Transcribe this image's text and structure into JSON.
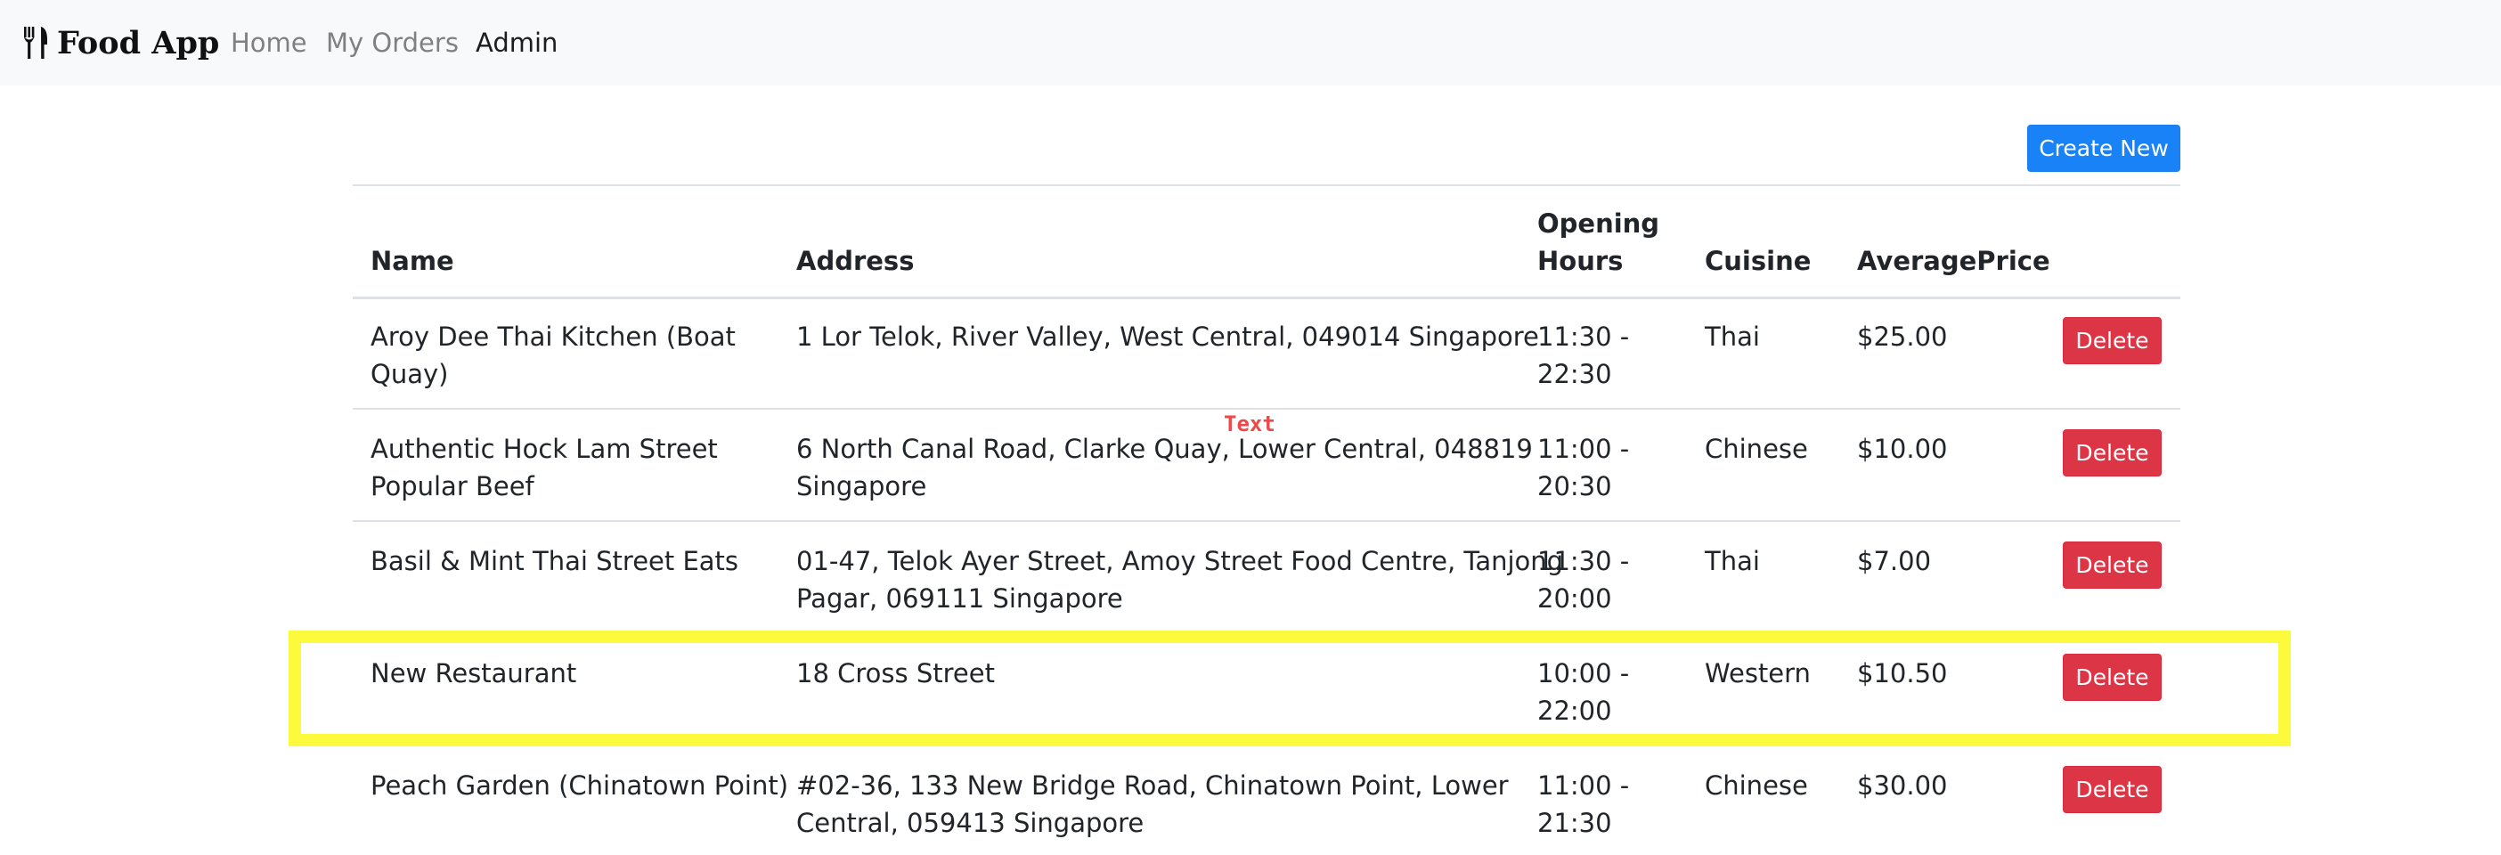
{
  "navbar": {
    "brand": "Food App",
    "brand_icon": "fork-knife-icon",
    "links": [
      "Home",
      "My Orders",
      "Admin"
    ],
    "active_link": "Admin"
  },
  "actions": {
    "create_label": "Create New"
  },
  "table": {
    "headers": {
      "name": "Name",
      "address": "Address",
      "hours_line1": "Opening",
      "hours_line2": "Hours",
      "cuisine": "Cuisine",
      "price": "AveragePrice"
    },
    "rows": [
      {
        "name_l1": "Aroy Dee Thai Kitchen (Boat",
        "name_l2": "Quay)",
        "address_l1": "1 Lor Telok, River Valley, West Central, 049014 Singapore",
        "address_l2": "",
        "hours_l1": "11:30 -",
        "hours_l2": "22:30",
        "cuisine": "Thai",
        "price": "$25.00",
        "delete_label": "Delete"
      },
      {
        "name_l1": "Authentic Hock Lam Street",
        "name_l2": "Popular Beef",
        "address_l1": "6 North Canal Road, Clarke Quay, Lower Central, 048819",
        "address_l2": "Singapore",
        "hours_l1": "11:00 -",
        "hours_l2": "20:30",
        "cuisine": "Chinese",
        "price": "$10.00",
        "delete_label": "Delete"
      },
      {
        "name_l1": "Basil & Mint Thai Street Eats",
        "name_l2": "",
        "address_l1": "01-47, Telok Ayer Street, Amoy Street Food Centre, Tanjong",
        "address_l2": "Pagar, 069111 Singapore",
        "hours_l1": "11:30 -",
        "hours_l2": "20:00",
        "cuisine": "Thai",
        "price": "$7.00",
        "delete_label": "Delete"
      },
      {
        "name_l1": "New Restaurant",
        "name_l2": "",
        "address_l1": "18 Cross Street",
        "address_l2": "",
        "hours_l1": "10:00 -",
        "hours_l2": "22:00",
        "cuisine": "Western",
        "price": "$10.50",
        "delete_label": "Delete"
      },
      {
        "name_l1": "Peach Garden (Chinatown Point)",
        "name_l2": "",
        "address_l1": "#02-36, 133 New Bridge Road, Chinatown Point, Lower",
        "address_l2": "Central, 059413 Singapore",
        "hours_l1": "11:00 -",
        "hours_l2": "21:30",
        "cuisine": "Chinese",
        "price": "$30.00",
        "delete_label": "Delete"
      }
    ]
  },
  "overlay": {
    "label": "Text",
    "highlight_color": "#fdf93d"
  },
  "colors": {
    "primary": "#1a82f7",
    "danger": "#dc3545",
    "navbar_bg": "#f8f9fa"
  }
}
